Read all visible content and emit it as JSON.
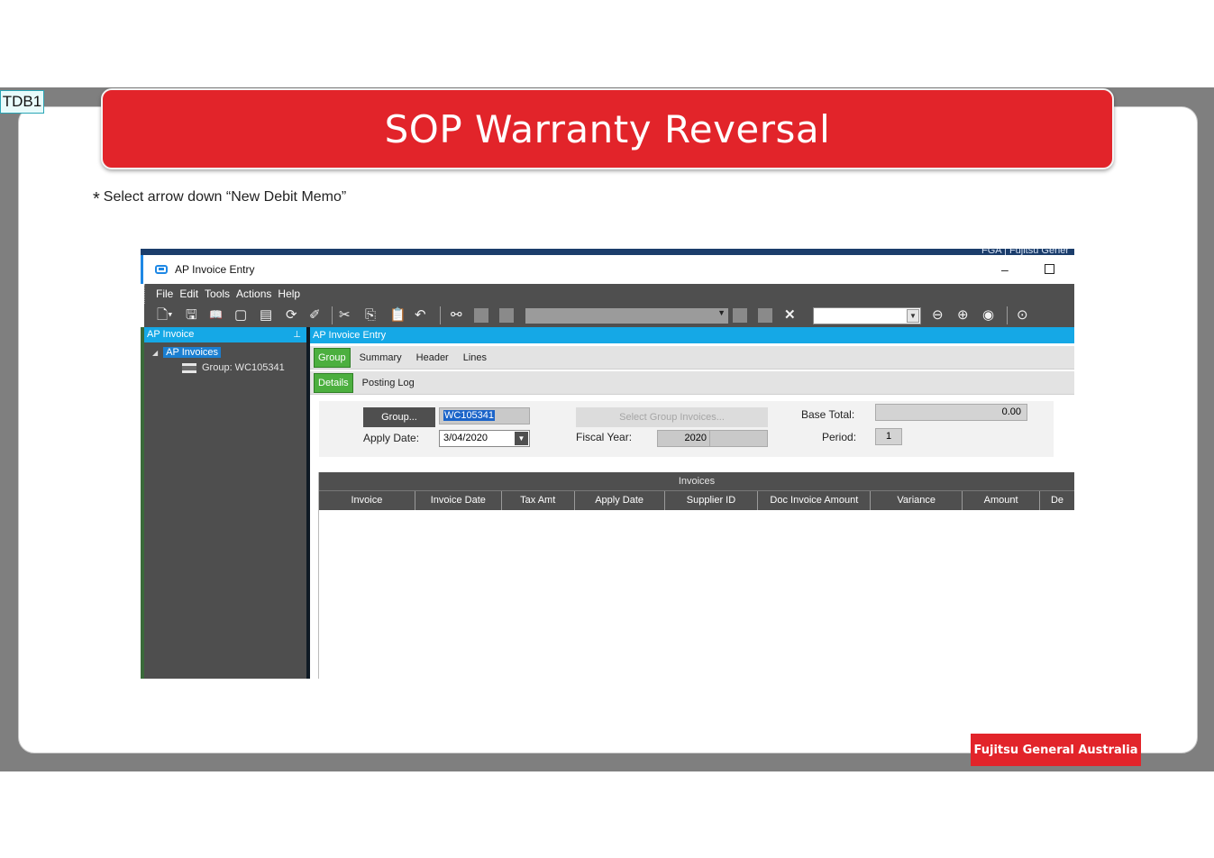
{
  "slide": {
    "tag": "TDB1",
    "title": "SOP Warranty Reversal",
    "instruction_bullet": "*",
    "instruction": "Select arrow down “New Debit Memo”",
    "footer_brand": "Fujitsu General Australia",
    "colors": {
      "accent_red": "#e2242a",
      "band_gray": "#7f7f7f"
    }
  },
  "window": {
    "title": "AP Invoice Entry",
    "topstrip_text": "FGA | Fujitsu Gener",
    "minimize": "–",
    "menu": [
      "File",
      "Edit",
      "Tools",
      "Actions",
      "Help"
    ]
  },
  "toolbar": {
    "icons": [
      "new-icon",
      "save-icon",
      "open-book-icon",
      "note-icon",
      "attach-icon",
      "refresh-icon",
      "clear-icon",
      "cut-icon",
      "copy-icon",
      "paste-icon",
      "undo-icon",
      "binoculars-icon",
      "first-icon",
      "prev-icon",
      "next-icon",
      "last-icon",
      "delete-icon",
      "back-icon",
      "forward-icon",
      "home-icon",
      "play-icon"
    ]
  },
  "left_panel": {
    "header": "AP Invoice",
    "root": "AP Invoices",
    "child": "Group: WC105341"
  },
  "right_panel": {
    "header": "AP Invoice Entry",
    "tabs_row1": [
      "Group",
      "Summary",
      "Header",
      "Lines"
    ],
    "tabs_row2": [
      "Details",
      "Posting Log"
    ],
    "form": {
      "group_button": "Group...",
      "group_value": "WC105341",
      "apply_date_label": "Apply Date:",
      "apply_date_value": "3/04/2020",
      "select_group_invoices": "Select Group Invoices...",
      "fiscal_year_label": "Fiscal Year:",
      "fiscal_year_value": "2020",
      "base_total_label": "Base Total:",
      "base_total_value": "0.00",
      "period_label": "Period:",
      "period_value": "1"
    },
    "grid": {
      "caption": "Invoices",
      "columns": [
        "Invoice",
        "Invoice Date",
        "Tax Amt",
        "Apply Date",
        "Supplier ID",
        "Doc Invoice Amount",
        "Variance",
        "Amount",
        "De"
      ]
    }
  }
}
